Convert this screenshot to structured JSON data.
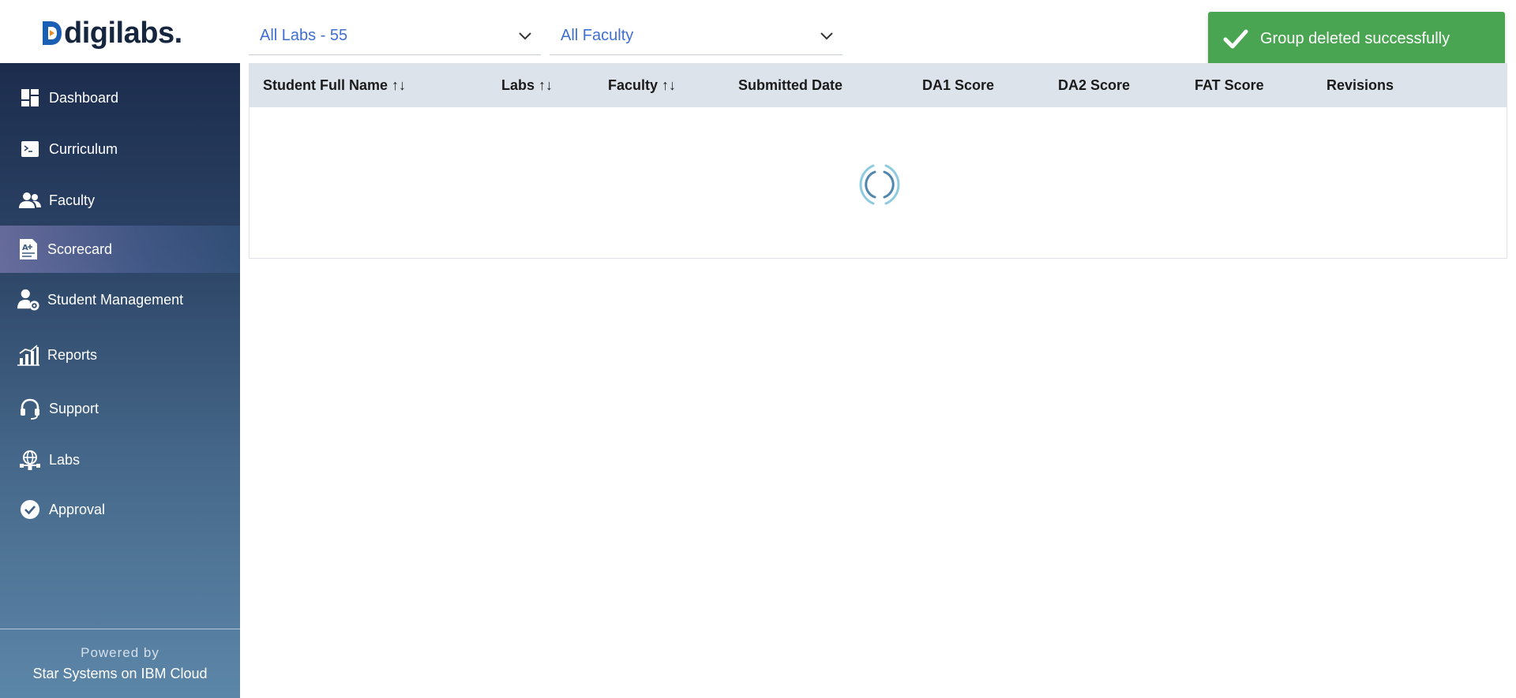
{
  "brand": {
    "logo_text": "digilabs."
  },
  "filters": {
    "labs": {
      "value": "All Labs - 55"
    },
    "faculty": {
      "value": "All Faculty"
    }
  },
  "toast": {
    "message": "Group deleted successfully",
    "color": "#4aa552"
  },
  "sidebar": {
    "items": [
      {
        "label": "Dashboard",
        "icon": "dashboard-icon"
      },
      {
        "label": "Curriculum",
        "icon": "terminal-icon"
      },
      {
        "label": "Faculty",
        "icon": "people-icon"
      },
      {
        "label": "Scorecard",
        "icon": "scorecard-icon",
        "active": true
      },
      {
        "label": "Student Management",
        "icon": "user-settings-icon"
      },
      {
        "label": "Reports",
        "icon": "bar-chart-icon"
      },
      {
        "label": "Support",
        "icon": "headset-icon"
      },
      {
        "label": "Labs",
        "icon": "globe-network-icon"
      },
      {
        "label": "Approval",
        "icon": "check-circle-icon"
      }
    ],
    "footer": {
      "powered_by": "Powered by",
      "provider": "Star Systems on IBM Cloud"
    }
  },
  "table": {
    "columns": [
      {
        "label": "Student Full Name",
        "sortable": true
      },
      {
        "label": "Labs",
        "sortable": true
      },
      {
        "label": "Faculty",
        "sortable": true
      },
      {
        "label": "Submitted Date",
        "sortable": false
      },
      {
        "label": "DA1 Score",
        "sortable": false
      },
      {
        "label": "DA2 Score",
        "sortable": false
      },
      {
        "label": "FAT Score",
        "sortable": false
      },
      {
        "label": "Revisions",
        "sortable": false
      }
    ],
    "sort_glyph": "↑↓",
    "loading": true
  }
}
